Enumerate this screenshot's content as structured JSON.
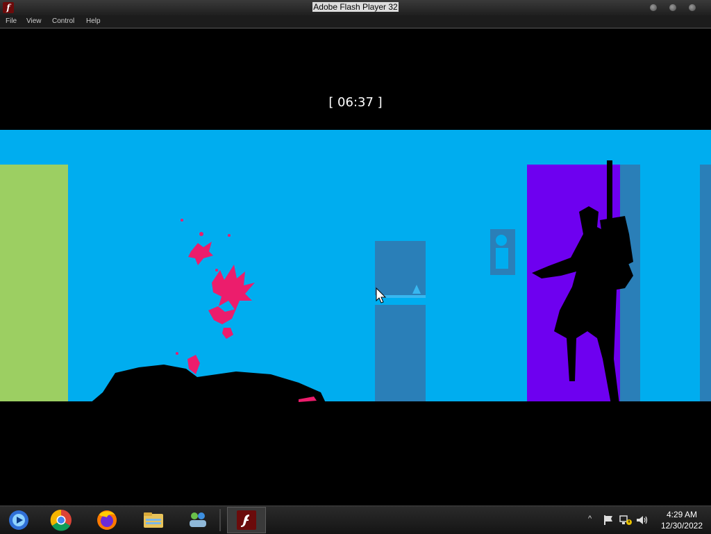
{
  "window": {
    "title": "Adobe Flash Player 32",
    "app_icon_glyph": "f"
  },
  "menu": {
    "items": [
      "File",
      "View",
      "Control",
      "Help"
    ]
  },
  "game": {
    "timer": "[ 06:37 ]",
    "colors": {
      "sky": "#00adef",
      "wall_green": "#9ccf62",
      "door_purple": "#6e00f0",
      "panel_blue": "#2a7fb8",
      "blood": "#ec1d6c",
      "silhouette": "#000000"
    }
  },
  "taskbar": {
    "apps": [
      "media-player-icon",
      "chrome-icon",
      "firefox-icon",
      "file-explorer-icon",
      "network-people-icon",
      "flash-player-icon"
    ],
    "tray": {
      "chevron": "^"
    },
    "clock": {
      "time": "4:29 AM",
      "date": "12/30/2022"
    }
  }
}
